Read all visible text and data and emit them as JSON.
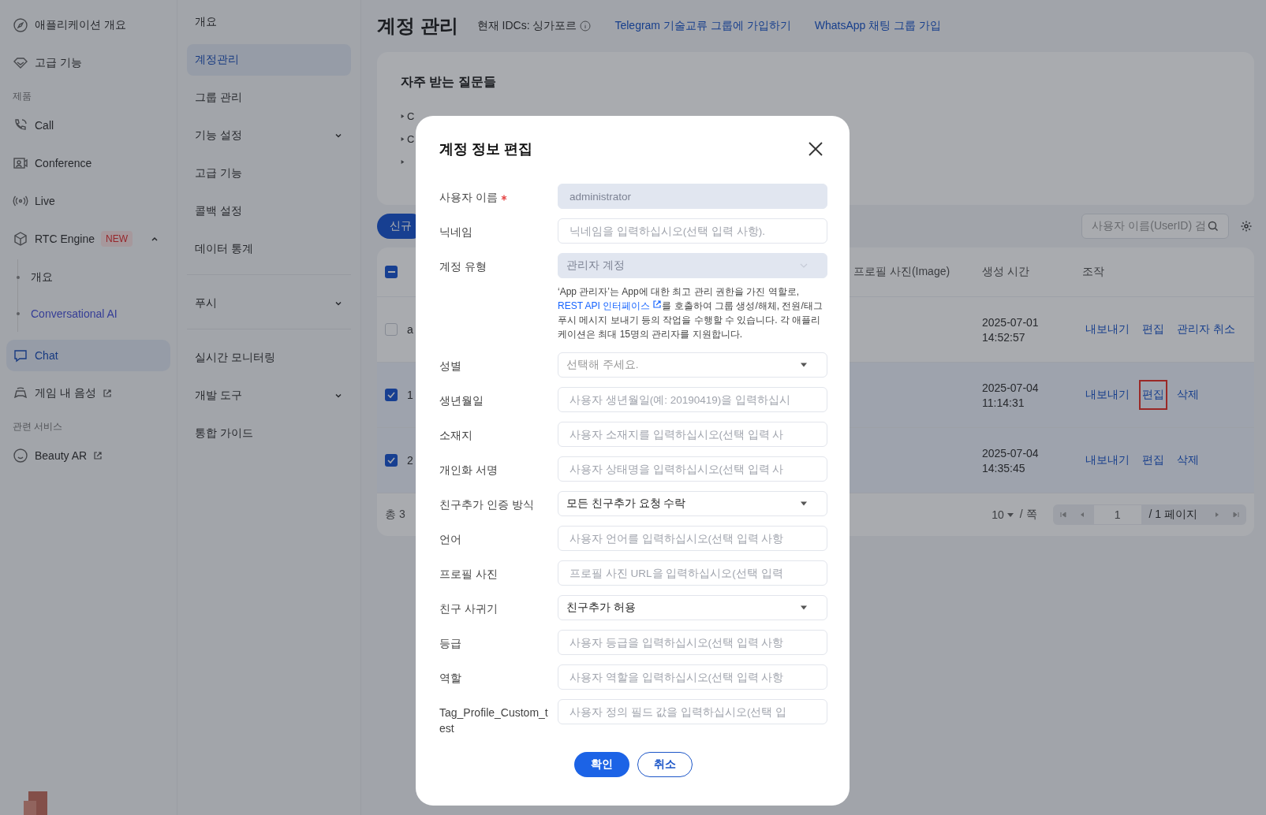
{
  "nav": {
    "items": [
      {
        "kind": "item",
        "label": "애플리케이션 개요",
        "selected": false
      },
      {
        "kind": "item",
        "label": "고급 기능",
        "selected": false
      },
      {
        "kind": "section",
        "label": "제품"
      },
      {
        "kind": "item",
        "label": "Call",
        "selected": false
      },
      {
        "kind": "item",
        "label": "Conference",
        "selected": false
      },
      {
        "kind": "item",
        "label": "Live",
        "selected": false
      },
      {
        "kind": "item",
        "label": "RTC Engine",
        "badge": "NEW",
        "expanded": true,
        "selected": false,
        "children": [
          {
            "label": "개요",
            "kind": "plain"
          },
          {
            "label": "Conversational AI",
            "kind": "promo"
          }
        ]
      },
      {
        "kind": "item",
        "label": "Chat",
        "selected": true
      },
      {
        "kind": "item",
        "label": "게임 내 음성",
        "external": true,
        "selected": false
      },
      {
        "kind": "section",
        "label": "관련 서비스"
      },
      {
        "kind": "item",
        "label": "Beauty AR",
        "external": true,
        "selected": false
      }
    ]
  },
  "subnav": {
    "groups": [
      [
        {
          "label": "개요",
          "selected": false
        },
        {
          "label": "계정관리",
          "selected": true
        },
        {
          "label": "그룹 관리",
          "selected": false
        },
        {
          "label": "기능 설정",
          "selected": false,
          "expandable": true
        },
        {
          "label": "고급 기능",
          "selected": false
        },
        {
          "label": "콜백 설정",
          "selected": false
        },
        {
          "label": "데이터 통계",
          "selected": false
        }
      ],
      [
        {
          "label": "푸시",
          "selected": false,
          "expandable": true
        }
      ],
      [
        {
          "label": "실시간 모니터링",
          "selected": false
        },
        {
          "label": "개발 도구",
          "selected": false,
          "expandable": true
        },
        {
          "label": "통합 가이드",
          "selected": false
        }
      ]
    ]
  },
  "header": {
    "title": "계정 관리",
    "region": "현재 IDCs: 싱가포르",
    "links": [
      "Telegram 기술교류 그룹에 가입하기",
      "WhatsApp 채팅 그룹 가입"
    ]
  },
  "faq": {
    "title": "자주 받는 질문들",
    "items": [
      {
        "text": "C",
        "expanded": false
      },
      {
        "text": "C",
        "expanded": false
      },
      {
        "expanded": false
      }
    ]
  },
  "toolbar": {
    "new_button": "신규",
    "search": {
      "placeholder": "사용자 이름(UserID) 검"
    }
  },
  "table": {
    "select_all": {
      "indeterminate": true
    },
    "columns": [
      "프로필 사진(Image)",
      "생성 시간",
      "조작"
    ],
    "rows": [
      {
        "checked": false,
        "column_1": "a",
        "date": "2025-07-01",
        "time": "14:52:57",
        "actions": [
          {
            "label": "내보내기",
            "highlighted": false
          },
          {
            "label": "편집",
            "highlighted": false
          },
          {
            "label": "관리자 취소",
            "highlighted": false
          }
        ]
      },
      {
        "checked": true,
        "column_1": "1",
        "date": "2025-07-04",
        "time": "11:14:31",
        "actions": [
          {
            "label": "내보내기",
            "highlighted": false
          },
          {
            "label": "편집",
            "highlighted": true
          },
          {
            "label": "삭제",
            "highlighted": false
          }
        ]
      },
      {
        "checked": true,
        "column_1": "2",
        "date": "2025-07-04",
        "time": "14:35:45",
        "actions": [
          {
            "label": "내보내기",
            "highlighted": false
          },
          {
            "label": "편집",
            "highlighted": false
          },
          {
            "label": "삭제",
            "highlighted": false
          }
        ]
      }
    ],
    "total": "총 3",
    "page_size": "10",
    "per_page_unit": "/ 쪽",
    "page": "1",
    "pages": "/ 1 페이지"
  },
  "dialog": {
    "title": "계정 정보 편집",
    "fields": [
      {
        "label": "사용자 이름",
        "required": true,
        "kind": "input",
        "value": "administrator",
        "disabled": true
      },
      {
        "label": "닉네임",
        "kind": "input",
        "disabled": false,
        "placeholder": "닉네임을 입력하십시오(선택 입력 사항)."
      },
      {
        "label": "계정 유형",
        "kind": "select",
        "value": "관리자 계정",
        "disabled": true,
        "help": {
          "before": "‘App 관리자’는 App에 대한 최고 관리 권한을 가진 역할로,",
          "link": "REST API 인터페이스",
          "after": "를 호출하여 그룹 생성/해체, 전원/태그 푸시 메시지 보내기 등의 작업을 수행할 수 있습니다. 각 애플리케이션은 최대 15명의 관리자를 지원합니다."
        }
      },
      {
        "label": "성별",
        "kind": "select",
        "disabled": false,
        "placeholder": "선택해 주세요."
      },
      {
        "label": "생년월일",
        "kind": "input",
        "disabled": false,
        "placeholder": "사용자 생년월일(예: 20190419)을 입력하십시"
      },
      {
        "label": "소재지",
        "kind": "input",
        "disabled": false,
        "placeholder": "사용자 소재지를 입력하십시오(선택 입력 사"
      },
      {
        "label": "개인화 서명",
        "kind": "input",
        "disabled": false,
        "placeholder": "사용자 상태명을 입력하십시오(선택 입력 사"
      },
      {
        "label": "친구추가 인증 방식",
        "kind": "select",
        "disabled": false,
        "value": "모든 친구추가 요청 수락"
      },
      {
        "label": "언어",
        "kind": "input",
        "disabled": false,
        "placeholder": "사용자 언어를 입력하십시오(선택 입력 사항"
      },
      {
        "label": "프로필 사진",
        "kind": "input",
        "disabled": false,
        "placeholder": "프로필 사진 URL을 입력하십시오(선택 입력"
      },
      {
        "label": "친구 사귀기",
        "kind": "select",
        "disabled": false,
        "value": "친구추가 허용"
      },
      {
        "label": "등급",
        "kind": "input",
        "disabled": false,
        "placeholder": "사용자 등급을 입력하십시오(선택 입력 사항"
      },
      {
        "label": "역할",
        "kind": "input",
        "disabled": false,
        "placeholder": "사용자 역할을 입력하십시오(선택 입력 사항"
      },
      {
        "label": "Tag_Profile_Custom_test",
        "kind": "input",
        "disabled": false,
        "placeholder": "사용자 정의 필드 값을 입력하십시오(선택 입"
      }
    ],
    "buttons": [
      {
        "label": "확인",
        "kind": "primary"
      },
      {
        "label": "취소",
        "kind": "secondary"
      }
    ]
  }
}
